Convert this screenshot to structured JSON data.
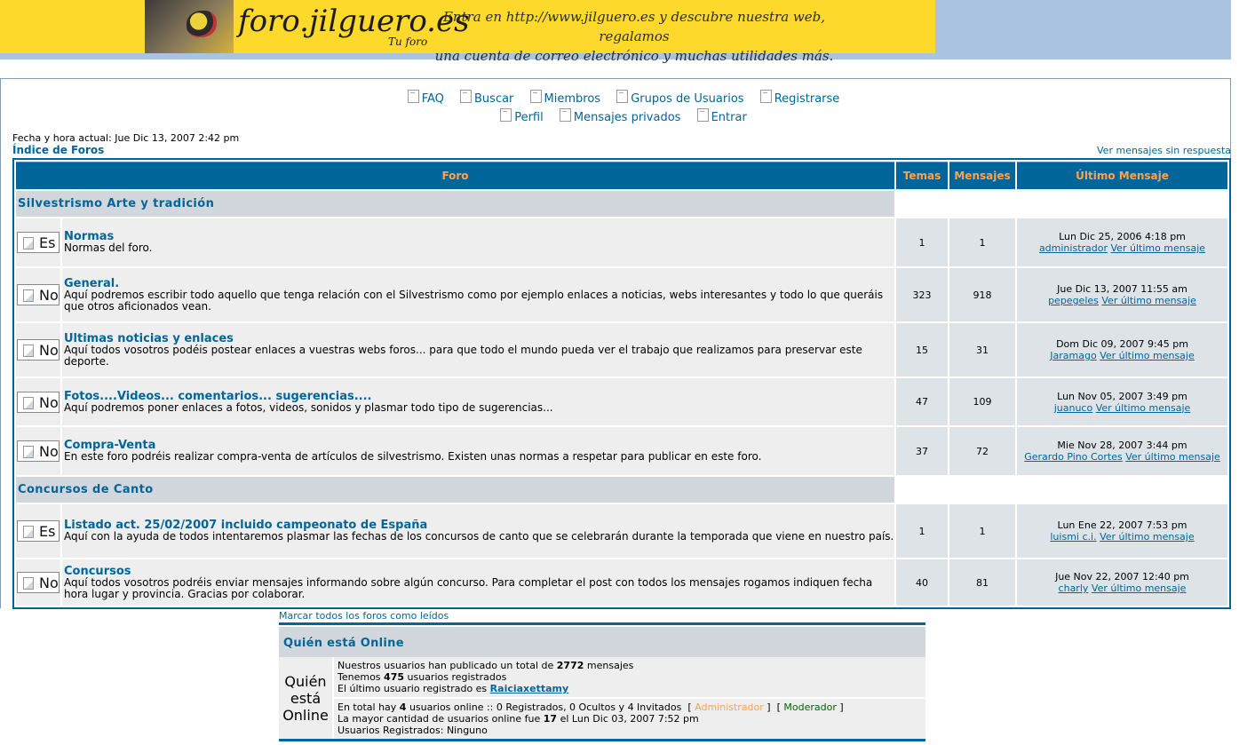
{
  "banner": {
    "logo_text": "foro.jilguero.es",
    "tagline": "Tu foro",
    "promo_line1": "Entra en http://www.jilguero.es y descubre nuestra web, regalamos",
    "promo_line2": "una cuenta de correo electrónico y muchas utilidades más."
  },
  "nav": {
    "faq": "FAQ",
    "search": "Buscar",
    "members": "Miembros",
    "groups": "Grupos de Usuarios",
    "register": "Registrarse",
    "profile": "Perfil",
    "pm": "Mensajes privados",
    "login": "Entrar"
  },
  "header": {
    "datetime": "Fecha y hora actual: Jue Dic 13, 2007 2:42 pm",
    "index": "Índice de Foros",
    "unanswered": "Ver mensajes sin respuesta"
  },
  "table": {
    "col_forum": "Foro",
    "col_topics": "Temas",
    "col_posts": "Mensajes",
    "col_last": "Último Mensaje"
  },
  "categories": [
    {
      "name": "Silvestrismo Arte y tradición",
      "forums": [
        {
          "icon_alt": "Es",
          "name": "Normas",
          "desc": "Normas del foro.",
          "topics": "1",
          "posts": "1",
          "last_date": "Lun Dic 25, 2006 4:18 pm",
          "last_user": "administrador",
          "view_last": "Ver último mensaje"
        },
        {
          "icon_alt": "No",
          "name": "General.",
          "desc": "Aquí podremos escribir todo aquello que tenga relación con el Silvestrismo como por ejemplo enlaces a noticias, webs interesantes y todo lo que queráis que otros aficionados vean.",
          "topics": "323",
          "posts": "918",
          "last_date": "Jue Dic 13, 2007 11:55 am",
          "last_user": "pepegeles",
          "view_last": "Ver último mensaje"
        },
        {
          "icon_alt": "No",
          "name": "Ultimas noticias y enlaces",
          "desc": "Aquí todos vosotros podéis postear enlaces a vuestras webs foros... para que todo el mundo pueda ver el trabajo que realizamos para preservar este deporte.",
          "topics": "15",
          "posts": "31",
          "last_date": "Dom Dic 09, 2007 9:45 pm",
          "last_user": "Jaramago",
          "view_last": "Ver último mensaje"
        },
        {
          "icon_alt": "No",
          "name": "Fotos....Videos... comentarios... sugerencias....",
          "desc": "Aquí podremos poner enlaces a fotos, videos, sonidos y plasmar todo tipo de sugerencias...",
          "topics": "47",
          "posts": "109",
          "last_date": "Lun Nov 05, 2007 3:49 pm",
          "last_user": "juanuco",
          "view_last": "Ver último mensaje"
        },
        {
          "icon_alt": "No",
          "name": "Compra-Venta",
          "desc": "En este foro podréis realizar compra-venta de artículos de silvestrismo. Existen unas normas a respetar para publicar en este foro.",
          "topics": "37",
          "posts": "72",
          "last_date": "Mie Nov 28, 2007 3:44 pm",
          "last_user": "Gerardo Pino Cortes",
          "view_last": "Ver último mensaje"
        }
      ]
    },
    {
      "name": "Concursos de Canto",
      "forums": [
        {
          "icon_alt": "Es",
          "name": "Listado act. 25/02/2007 incluido campeonato de España",
          "desc": "Aquí con la ayuda de todos intentaremos plasmar las fechas de los concursos de canto que se celebrarán durante la temporada que viene en nuestro país.",
          "topics": "1",
          "posts": "1",
          "last_date": "Lun Ene 22, 2007 7:53 pm",
          "last_user": "luismi c.i.",
          "view_last": "Ver último mensaje"
        },
        {
          "icon_alt": "No",
          "name": "Concursos",
          "desc": "Aquí todos vosotros podréis enviar mensajes informando sobre algún concurso. Para completar el post con todos los mensajes rogamos indiquen fecha hora lugar y provincia. Gracias por colaborar.",
          "topics": "40",
          "posts": "81",
          "last_date": "Jue Nov 22, 2007 12:40 pm",
          "last_user": "charly",
          "view_last": "Ver último mensaje"
        }
      ]
    }
  ],
  "mark_read": "Marcar todos los foros como leídos",
  "online": {
    "title": "Quién está Online",
    "label": "Quién está Online",
    "posts_pre": "Nuestros usuarios han publicado un total de",
    "posts_count": "2772",
    "posts_post": "mensajes",
    "users_pre": "Tenemos",
    "users_count": "475",
    "users_post": "usuarios registrados",
    "last_user_pre": "El último usuario registrado es",
    "last_user": "Raiciaxettamy",
    "online_pre": "En total hay",
    "online_count": "4",
    "online_post": "usuarios online :: 0 Registrados, 0 Ocultos y 4 Invitados",
    "admin_open": "[",
    "admin": "Administrador",
    "admin_close": "]",
    "mod_open": "[",
    "mod": "Moderador",
    "mod_close": "]",
    "max_pre": "La mayor cantidad de usuarios online fue",
    "max_count": "17",
    "max_post": "el Lun Dic 03, 2007 7:52 pm",
    "registered": "Usuarios Registrados: Ninguno"
  }
}
